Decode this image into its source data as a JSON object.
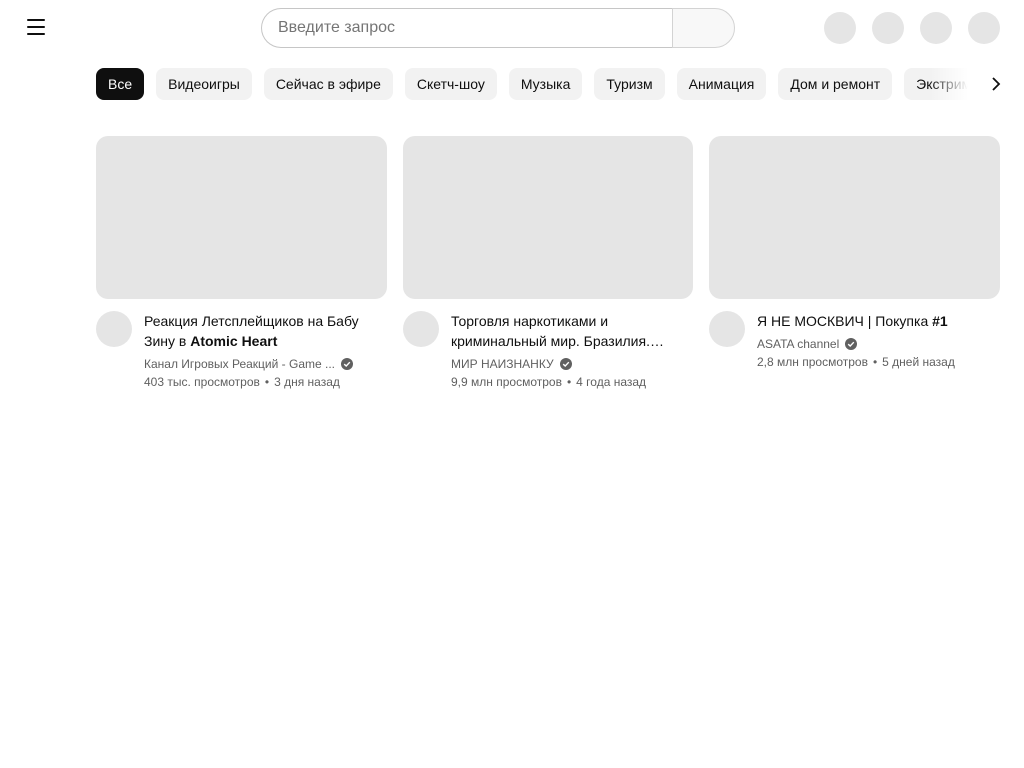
{
  "search": {
    "placeholder": "Введите запрос"
  },
  "header": {
    "icons": [
      "menu-icon",
      "search-icon",
      "create-icon",
      "notifications-icon",
      "avatar-icon"
    ]
  },
  "chips": [
    {
      "label": "Все",
      "active": true
    },
    {
      "label": "Видеоигры"
    },
    {
      "label": "Сейчас в эфире"
    },
    {
      "label": "Скетч-шоу"
    },
    {
      "label": "Музыка"
    },
    {
      "label": "Туризм"
    },
    {
      "label": "Анимация"
    },
    {
      "label": "Дом и ремонт"
    },
    {
      "label": "Экстрим"
    }
  ],
  "videos": [
    {
      "title_plain": "Реакция Летсплейщиков на Бабу Зину в ",
      "title_bold": "Atomic Heart",
      "channel": "Канал Игровых Реакций - Game ...",
      "views": "403 тыс. просмотров",
      "age": "3 дня назад",
      "verified": true
    },
    {
      "title_plain": "Торговля наркотиками и криминальный мир. Бразилия. Рио-де-Жанейро",
      "title_bold": "",
      "channel": "МИР НАИЗНАНКУ",
      "views": "9,9 млн просмотров",
      "age": "4 года назад",
      "verified": true
    },
    {
      "title_plain": "Я НЕ МОСКВИЧ | Покупка ",
      "title_bold": "#1",
      "channel": "ASATA channel",
      "views": "2,8 млн просмотров",
      "age": "5 дней назад",
      "verified": true
    }
  ],
  "colors": {
    "placeholder_gray": "#e5e5e5",
    "chip_bg": "#f2f2f2",
    "chip_active_bg": "#0f0f0f",
    "meta_text": "#606060"
  }
}
